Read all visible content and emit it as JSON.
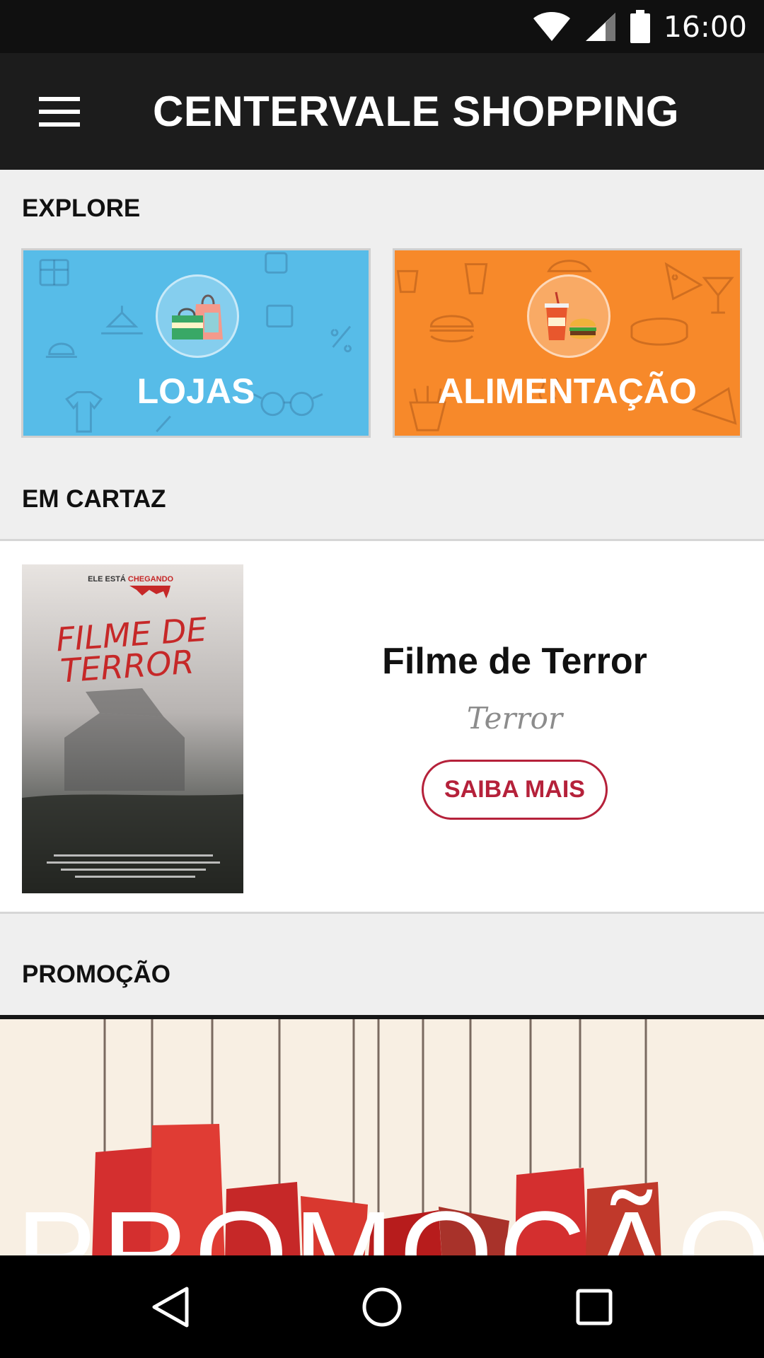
{
  "status_bar": {
    "time": "16:00",
    "icons": [
      "wifi-icon",
      "signal-icon",
      "battery-icon"
    ]
  },
  "app_bar": {
    "title": "CENTERVALE SHOPPING",
    "menu_icon": "hamburger-menu-icon"
  },
  "explore": {
    "heading": "EXPLORE",
    "tiles": [
      {
        "label": "LOJAS",
        "icon": "shopping-bags-icon",
        "color": "#57bce8"
      },
      {
        "label": "ALIMENTAÇÃO",
        "icon": "food-drink-icon",
        "color": "#f7892a"
      }
    ]
  },
  "em_cartaz": {
    "heading": "EM CARTAZ",
    "movie": {
      "title": "Filme de Terror",
      "genre": "Terror",
      "button_label": "SAIBA MAIS",
      "poster": {
        "tagline_prefix": "ELE ESTÁ",
        "tagline_highlight": "CHEGANDO",
        "title_line1": "FILME DE",
        "title_line2": "TERROR"
      }
    }
  },
  "promocao": {
    "heading": "PROMOÇÃO",
    "banner_text": "PROMOÇÃO"
  },
  "colors": {
    "accent": "#b5213a",
    "app_bar": "#1c1c1c",
    "status_bar": "#101010",
    "background": "#efefef"
  },
  "nav_bar": {
    "buttons": [
      "back-icon",
      "home-icon",
      "recents-icon"
    ]
  }
}
